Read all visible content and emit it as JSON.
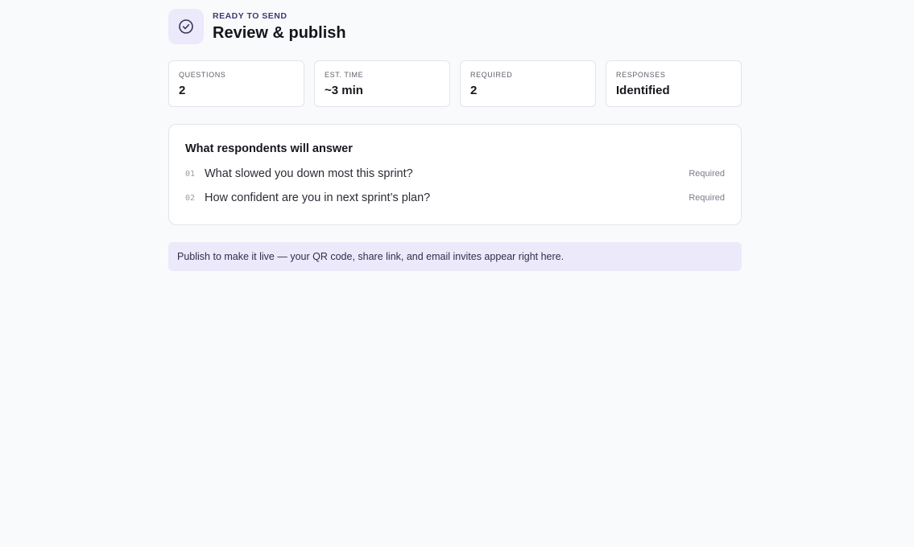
{
  "header": {
    "eyebrow": "READY TO SEND",
    "title": "Review & publish",
    "icon": "check-circle-icon",
    "accent_color": "#3d3a73",
    "icon_bg_color": "#ece9fb"
  },
  "stats": [
    {
      "label": "QUESTIONS",
      "value": "2"
    },
    {
      "label": "EST. TIME",
      "value": "~3 min"
    },
    {
      "label": "REQUIRED",
      "value": "2"
    },
    {
      "label": "RESPONSES",
      "value": "Identified"
    }
  ],
  "questions_card": {
    "title": "What respondents will answer",
    "items": [
      {
        "number": "01",
        "text": "What slowed you down most this sprint?",
        "tag": "Required"
      },
      {
        "number": "02",
        "text": "How confident are you in next sprint’s plan?",
        "tag": "Required"
      }
    ]
  },
  "notice": {
    "text": "Publish to make it live — your QR code, share link, and email invites appear right here."
  }
}
